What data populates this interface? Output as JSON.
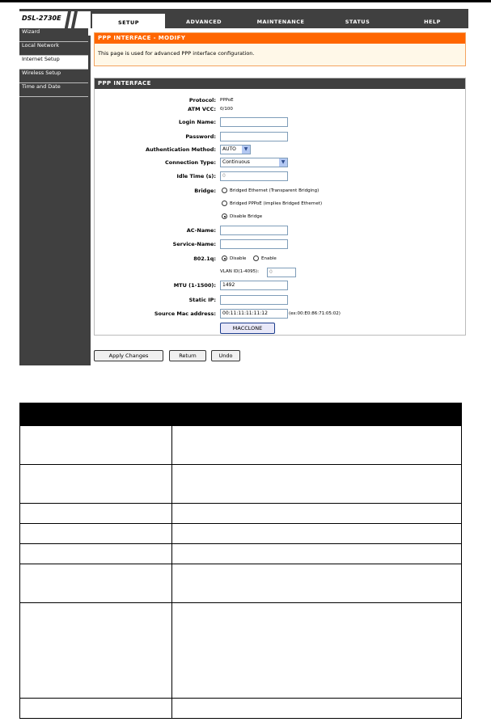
{
  "brand": {
    "model": "DSL-2730E"
  },
  "tabs": [
    "SETUP",
    "ADVANCED",
    "MAINTENANCE",
    "STATUS",
    "HELP"
  ],
  "sidebar": {
    "items": [
      "Wizard",
      "Local Network",
      "Internet Setup",
      "Wireless Setup",
      "Time and Date"
    ],
    "active": "Internet Setup"
  },
  "modify": {
    "title": "PPP INTERFACE - MODIFY",
    "description": "This page is used for advanced PPP interface configuration."
  },
  "ppp": {
    "title": "PPP INTERFACE",
    "protocol_label": "Protocol:",
    "protocol_value": "PPPoE",
    "atm_label": "ATM VCC:",
    "atm_value": "0/100",
    "login_label": "Login Name:",
    "login_value": "",
    "password_label": "Password:",
    "password_value": "",
    "auth_label": "Authentication Method:",
    "auth_value": "AUTO",
    "conn_label": "Connection Type:",
    "conn_value": "Continuous",
    "idle_label": "Idle Time (s):",
    "idle_value": "0",
    "bridge_label": "Bridge:",
    "bridge_options": [
      "Bridged Ethernet (Transparent Bridging)",
      "Bridged PPPoE (implies Bridged Ethernet)",
      "Disable Bridge"
    ],
    "bridge_selected": 2,
    "acname_label": "AC-Name:",
    "acname_value": "",
    "service_label": "Service-Name:",
    "service_value": "",
    "q_label": "802.1q:",
    "q_disable": "Disable",
    "q_enable": "Enable",
    "vlan_label": "VLAN ID(1-4095):",
    "vlan_value": "0",
    "mtu_label": "MTU (1-1500):",
    "mtu_value": "1492",
    "staticip_label": "Static IP:",
    "staticip_value": "",
    "mac_label": "Source Mac address:",
    "mac_value": "00:11:11:11:11:12",
    "mac_example": "(ex:00:E0:86:71:05:02)",
    "macclone_label": "MACCLONE"
  },
  "buttons": {
    "apply": "Apply Changes",
    "return": "Return",
    "undo": "Undo"
  },
  "colors": {
    "accent": "#ff6600",
    "dark": "#404040"
  }
}
